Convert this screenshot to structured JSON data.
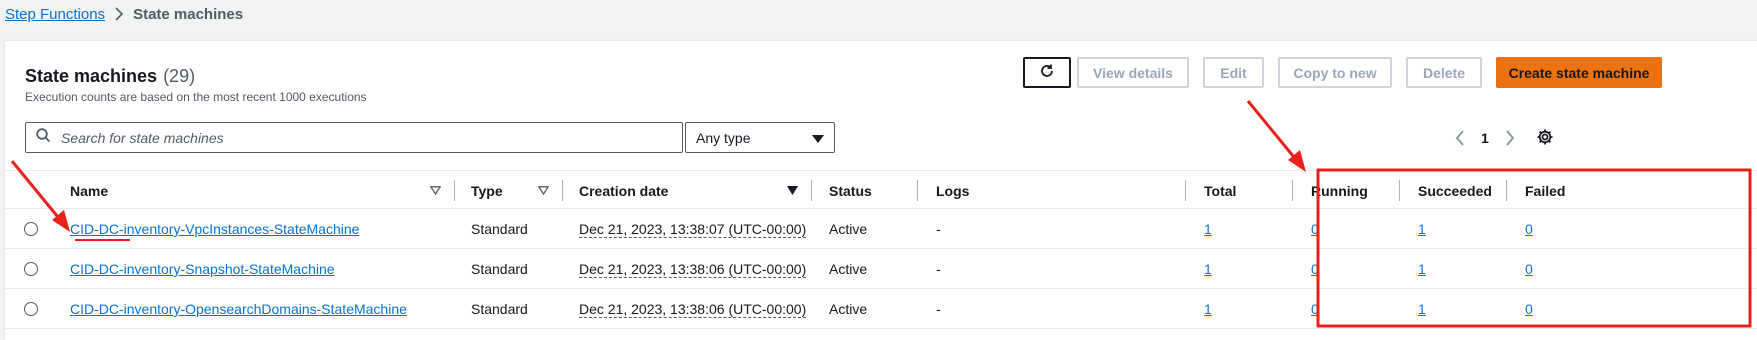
{
  "breadcrumb": {
    "root": "Step Functions",
    "current": "State machines"
  },
  "panel": {
    "title": "State machines",
    "count": "(29)",
    "description": "Execution counts are based on the most recent 1000 executions"
  },
  "toolbar": {
    "view_details": "View details",
    "edit": "Edit",
    "copy_to_new": "Copy to new",
    "delete": "Delete",
    "create": "Create state machine"
  },
  "search": {
    "placeholder": "Search for state machines"
  },
  "type_filter": {
    "selected": "Any type"
  },
  "pagination": {
    "page": "1"
  },
  "columns": {
    "name": "Name",
    "type": "Type",
    "creation_date": "Creation date",
    "status": "Status",
    "logs": "Logs",
    "total": "Total",
    "running": "Running",
    "succeeded": "Succeeded",
    "failed": "Failed"
  },
  "rows": [
    {
      "name": "CID-DC-inventory-VpcInstances-StateMachine",
      "type": "Standard",
      "created": "Dec 21, 2023, 13:38:07 (UTC-00:00)",
      "status": "Active",
      "logs": "-",
      "total": "1",
      "running": "0",
      "succeeded": "1",
      "failed": "0"
    },
    {
      "name": "CID-DC-inventory-Snapshot-StateMachine",
      "type": "Standard",
      "created": "Dec 21, 2023, 13:38:06 (UTC-00:00)",
      "status": "Active",
      "logs": "-",
      "total": "1",
      "running": "0",
      "succeeded": "1",
      "failed": "0"
    },
    {
      "name": "CID-DC-inventory-OpensearchDomains-StateMachine",
      "type": "Standard",
      "created": "Dec 21, 2023, 13:38:06 (UTC-00:00)",
      "status": "Active",
      "logs": "-",
      "total": "1",
      "running": "0",
      "succeeded": "1",
      "failed": "0"
    }
  ],
  "colors": {
    "accent": "#ec7211",
    "link": "#0972d3",
    "annotation": "#e8221b"
  }
}
